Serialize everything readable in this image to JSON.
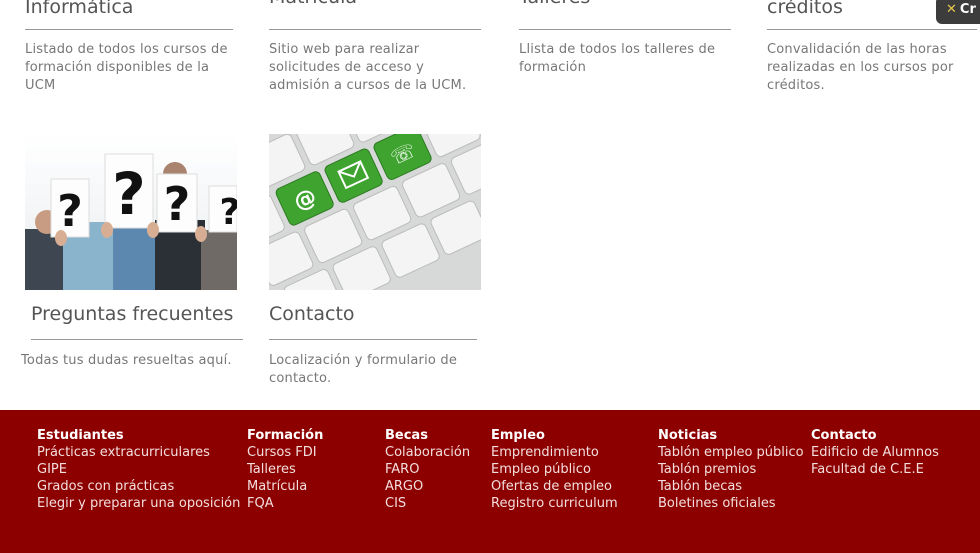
{
  "cards_top": [
    {
      "title": "Informática",
      "desc": "Listado de todos los cursos de formación disponibles de la UCM"
    },
    {
      "title": "Matrícula",
      "desc": "Sitio web para realizar solicitudes de acceso y admisión a cursos de la UCM."
    },
    {
      "title": "Talleres",
      "desc": "Llista de todos los talleres de formación"
    },
    {
      "title": "créditos",
      "desc": "Convalidación de las horas realizadas en los cursos por créditos."
    }
  ],
  "cards_bottom": [
    {
      "title": "Preguntas frecuentes",
      "desc": "Todas tus dudas resueltas aquí.",
      "image": "question-marks-crowd"
    },
    {
      "title": "Contacto",
      "desc": "Localización y formulario de contacto.",
      "image": "green-email-phone-keyboard"
    }
  ],
  "badge": {
    "label": "Cr",
    "icon": "cross-icon"
  },
  "footer": {
    "columns": [
      {
        "heading": "Estudiantes",
        "links": [
          "Prácticas extracurriculares",
          "GIPE",
          "Grados con prácticas",
          "Elegir y preparar una oposición"
        ]
      },
      {
        "heading": "Formación",
        "links": [
          "Cursos FDI",
          "Talleres",
          "Matrícula",
          "FQA"
        ]
      },
      {
        "heading": "Becas",
        "links": [
          "Colaboración",
          "FARO",
          "ARGO",
          "CIS"
        ]
      },
      {
        "heading": "Empleo",
        "links": [
          "Emprendimiento",
          "Empleo público",
          "Ofertas de empleo",
          "Registro curriculum"
        ]
      },
      {
        "heading": "Noticias",
        "links": [
          "Tablón empleo público",
          "Tablón premios",
          "Tablón becas",
          "Boletines oficiales"
        ]
      },
      {
        "heading": "Contacto",
        "links": [
          "Edificio de Alumnos",
          "Facultad de C.E.E"
        ]
      }
    ]
  },
  "colors": {
    "footer_bg": "#8d0000",
    "keys_green": "#3fa32f",
    "text": "#666666"
  }
}
